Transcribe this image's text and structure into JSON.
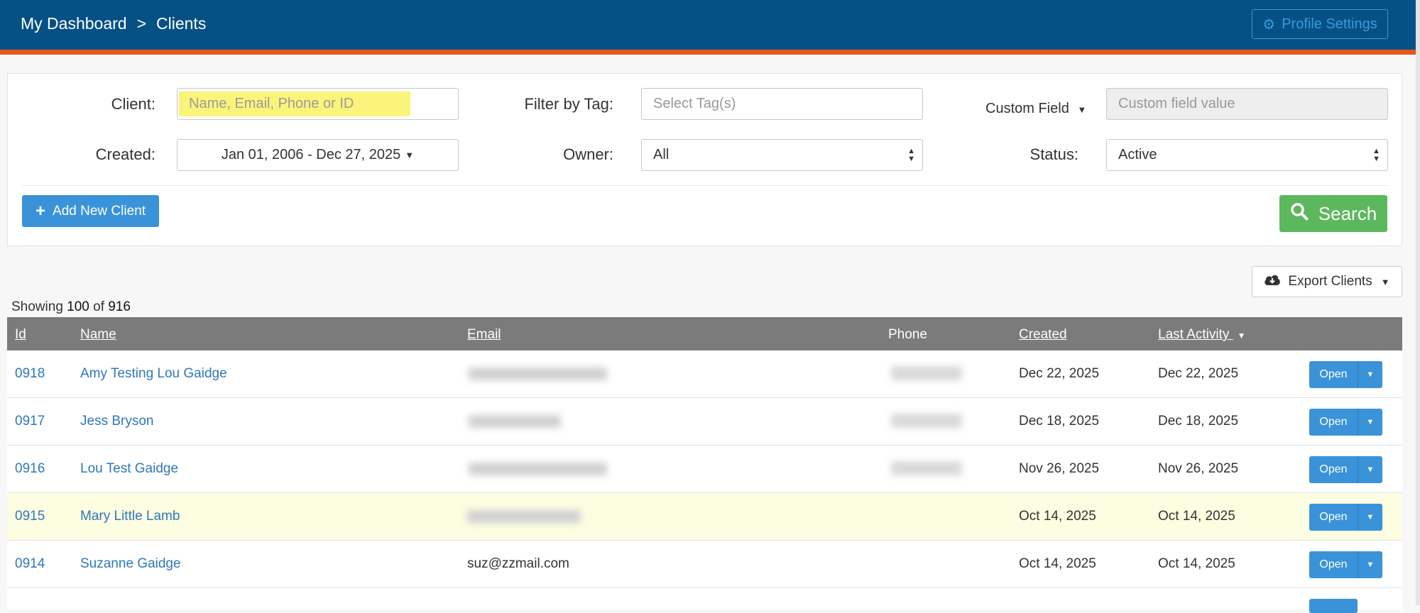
{
  "header": {
    "breadcrumb": [
      "My Dashboard",
      ">",
      "Clients"
    ],
    "profile_button": "Profile Settings"
  },
  "filters": {
    "client_label": "Client:",
    "client_placeholder": "Name, Email, Phone or ID",
    "tag_label": "Filter by Tag:",
    "tag_placeholder": "Select Tag(s)",
    "custom_field_label": "Custom Field",
    "custom_field_placeholder": "Custom field value",
    "created_label": "Created:",
    "created_value": "Jan 01, 2006 - Dec 27, 2025",
    "owner_label": "Owner:",
    "owner_value": "All",
    "status_label": "Status:",
    "status_value": "Active",
    "add_button": "Add New Client",
    "search_button": "Search"
  },
  "export_button": "Export Clients",
  "showing": {
    "prefix": "Showing",
    "count": "100",
    "of": "of",
    "total": "916"
  },
  "table": {
    "headers": {
      "id": "Id",
      "name": "Name",
      "email": "Email",
      "phone": "Phone",
      "created": "Created",
      "last_activity": "Last Activity"
    },
    "open_label": "Open",
    "rows": [
      {
        "id": "0918",
        "name": "Amy Testing Lou Gaidge",
        "email": "",
        "created": "Dec 22, 2025",
        "last_activity": "Dec 22, 2025"
      },
      {
        "id": "0917",
        "name": "Jess Bryson",
        "email": "",
        "created": "Dec 18, 2025",
        "last_activity": "Dec 18, 2025"
      },
      {
        "id": "0916",
        "name": "Lou Test Gaidge",
        "email": "",
        "created": "Nov 26, 2025",
        "last_activity": "Nov 26, 2025"
      },
      {
        "id": "0915",
        "name": "Mary Little Lamb",
        "email": "",
        "created": "Oct 14, 2025",
        "last_activity": "Oct 14, 2025"
      },
      {
        "id": "0914",
        "name": "Suzanne Gaidge",
        "email": "suz@zzmail.com",
        "created": "Oct 14, 2025",
        "last_activity": "Oct 14, 2025"
      }
    ]
  }
}
